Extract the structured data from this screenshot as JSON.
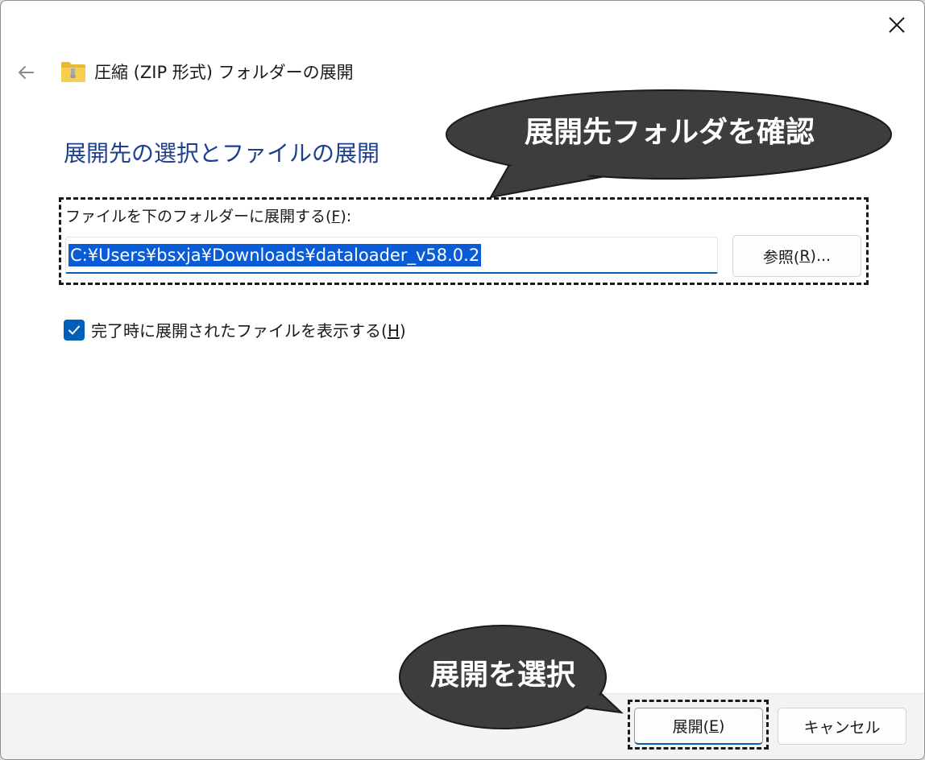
{
  "window": {
    "title": "圧縮 (ZIP 形式) フォルダーの展開",
    "close_icon": "close-icon",
    "back_icon": "back-arrow-icon",
    "folder_icon": "zip-folder-icon"
  },
  "main": {
    "heading": "展開先の選択とファイルの展開",
    "field_label_pre": "ファイルを下のフォルダーに展開する(",
    "field_label_key": "F",
    "field_label_post": "):",
    "path_value": "C:¥Users¥bsxja¥Downloads¥dataloader_v58.0.2",
    "browse_pre": "参照(",
    "browse_key": "R",
    "browse_post": ")...",
    "checkbox_checked": true,
    "checkbox_pre": "完了時に展開されたファイルを表示する(",
    "checkbox_key": "H",
    "checkbox_post": ")"
  },
  "footer": {
    "extract_pre": "展開(",
    "extract_key": "E",
    "extract_post": ")",
    "cancel_label": "キャンセル"
  },
  "annotations": {
    "callout_folder": "展開先フォルダを確認",
    "callout_extract": "展開を選択"
  },
  "colors": {
    "accent": "#005fb8",
    "heading": "#1e3f8f",
    "selection": "#0a5bd6",
    "callout_fill": "#3d3d3d"
  }
}
